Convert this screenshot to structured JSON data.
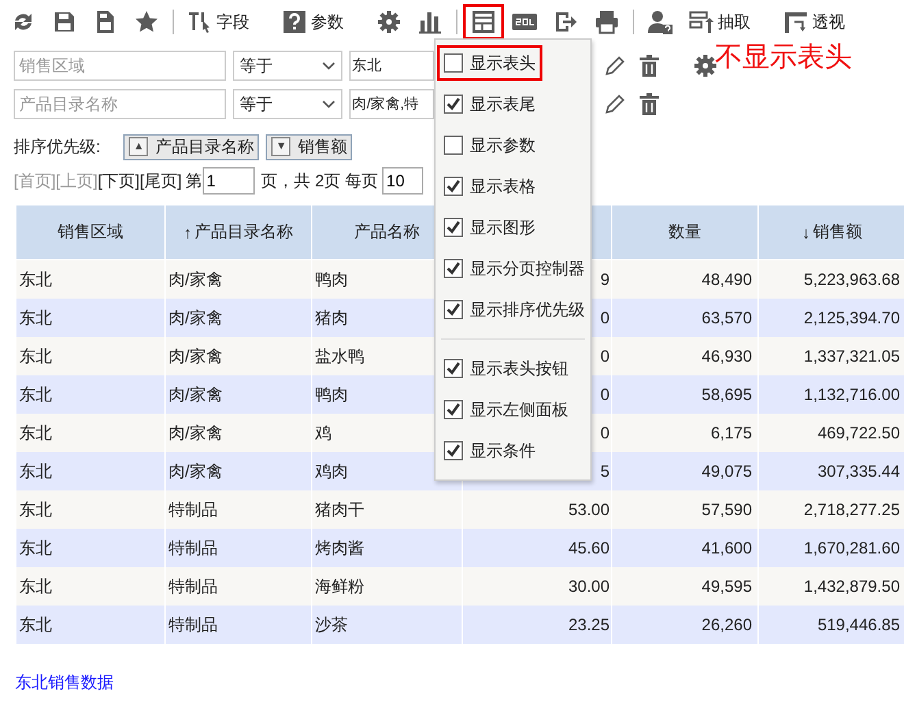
{
  "toolbar": {
    "items": [
      {
        "kind": "refresh",
        "highlighted": false
      },
      {
        "kind": "save",
        "highlighted": false
      },
      {
        "kind": "save-as",
        "highlighted": false
      },
      {
        "kind": "star",
        "highlighted": false
      },
      {
        "kind": "separator"
      },
      {
        "kind": "fields",
        "label": "字段",
        "highlighted": false
      },
      {
        "kind": "params",
        "label": "参数",
        "highlighted": false
      },
      {
        "kind": "gear",
        "highlighted": false
      },
      {
        "kind": "chart",
        "highlighted": false
      },
      {
        "kind": "separator"
      },
      {
        "kind": "layout",
        "highlighted": true
      },
      {
        "kind": "sql",
        "highlighted": false
      },
      {
        "kind": "export",
        "highlighted": false
      },
      {
        "kind": "print",
        "highlighted": false
      },
      {
        "kind": "separator"
      },
      {
        "kind": "user",
        "highlighted": false
      },
      {
        "kind": "extract",
        "label": "抽取",
        "highlighted": false
      },
      {
        "kind": "pivot",
        "label": "透视",
        "highlighted": false
      }
    ]
  },
  "filters": [
    {
      "field": "销售区域",
      "operator": "等于",
      "value": "东北",
      "settings": true
    },
    {
      "field": "产品目录名称",
      "operator": "等于",
      "value": "肉/家禽,特",
      "settings": false
    }
  ],
  "sort_priority": {
    "label": "排序优先级:",
    "keys": [
      {
        "icon": "▲",
        "label": "产品目录名称"
      },
      {
        "icon": "▼",
        "label": "销售额"
      }
    ]
  },
  "pagination": {
    "links": [
      {
        "label": "[首页]",
        "disabled": true
      },
      {
        "label": "[上页]",
        "disabled": true
      },
      {
        "label": "[下页]",
        "disabled": false
      },
      {
        "label": "[尾页]",
        "disabled": false
      }
    ],
    "page_prefix": "第",
    "page": "1",
    "page_suffix": "页，共 2页 每页",
    "page_size": "10"
  },
  "table": {
    "columns": [
      {
        "label": "销售区域"
      },
      {
        "label": "产品目录名称",
        "sort_arrow": "↑"
      },
      {
        "label": "产品名称"
      },
      {},
      {
        "label": "数量"
      },
      {
        "label": "销售额",
        "sort_arrow": "↓"
      }
    ],
    "rows": [
      [
        "东北",
        "肉/家禽",
        "鸭肉",
        "9",
        "48,490",
        "5,223,963.68"
      ],
      [
        "东北",
        "肉/家禽",
        "猪肉",
        "0",
        "63,570",
        "2,125,394.70"
      ],
      [
        "东北",
        "肉/家禽",
        "盐水鸭",
        "0",
        "46,930",
        "1,337,321.05"
      ],
      [
        "东北",
        "肉/家禽",
        "鸭肉",
        "0",
        "58,695",
        "1,132,716.00"
      ],
      [
        "东北",
        "肉/家禽",
        "鸡",
        "0",
        "6,175",
        "469,722.50"
      ],
      [
        "东北",
        "肉/家禽",
        "鸡肉",
        "5",
        "49,075",
        "307,335.44"
      ],
      [
        "东北",
        "特制品",
        "猪肉干",
        "53.00",
        "57,590",
        "2,718,277.25"
      ],
      [
        "东北",
        "特制品",
        "烤肉酱",
        "45.60",
        "41,600",
        "1,670,281.60"
      ],
      [
        "东北",
        "特制品",
        "海鲜粉",
        "30.00",
        "49,595",
        "1,432,879.50"
      ],
      [
        "东北",
        "特制品",
        "沙茶",
        "23.25",
        "26,260",
        "519,446.85"
      ]
    ]
  },
  "footer_link": "东北销售数据",
  "menu": {
    "items": [
      {
        "kind": "check",
        "label": "显示表头",
        "checked": false,
        "highlighted": true
      },
      {
        "kind": "check",
        "label": "显示表尾",
        "checked": true,
        "highlighted": false
      },
      {
        "kind": "check",
        "label": "显示参数",
        "checked": false,
        "highlighted": false
      },
      {
        "kind": "check",
        "label": "显示表格",
        "checked": true,
        "highlighted": false
      },
      {
        "kind": "check",
        "label": "显示图形",
        "checked": true,
        "highlighted": false
      },
      {
        "kind": "check",
        "label": "显示分页控制器",
        "checked": true,
        "highlighted": false
      },
      {
        "kind": "check",
        "label": "显示排序优先级",
        "checked": true,
        "highlighted": false
      },
      {
        "kind": "separator"
      },
      {
        "kind": "check",
        "label": "显示表头按钮",
        "checked": true,
        "highlighted": false
      },
      {
        "kind": "check",
        "label": "显示左侧面板",
        "checked": true,
        "highlighted": false
      },
      {
        "kind": "check",
        "label": "显示条件",
        "checked": true,
        "highlighted": false
      }
    ]
  },
  "annotation": "不显示表头"
}
